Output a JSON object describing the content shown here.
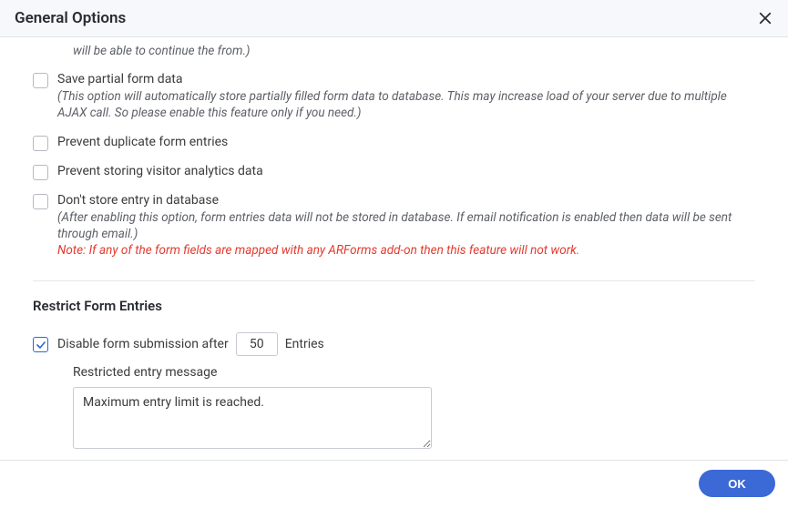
{
  "header": {
    "title": "General Options"
  },
  "options": {
    "truncated_desc": "will be able to continue the from.)",
    "save_partial": {
      "label": "Save partial form data",
      "desc": "(This option will automatically store partially filled form data to database. This may increase load of your server due to multiple AJAX call. So please enable this feature only if you need.)"
    },
    "prevent_duplicate": {
      "label": "Prevent duplicate form entries"
    },
    "prevent_analytics": {
      "label": "Prevent storing visitor analytics data"
    },
    "dont_store": {
      "label": "Don't store entry in database",
      "desc": "(After enabling this option, form entries data will not be stored in database. If email notification is enabled then data will be sent through email.)",
      "note": "Note: If any of the form fields are mapped with any ARForms add-on then this feature will not work."
    }
  },
  "restrict": {
    "heading": "Restrict Form Entries",
    "disable_label_pre": "Disable form submission after",
    "disable_value": "50",
    "disable_label_post": "Entries",
    "msg_label": "Restricted entry message",
    "msg_value": "Maximum entry limit is reached."
  },
  "footer": {
    "ok": "OK"
  }
}
